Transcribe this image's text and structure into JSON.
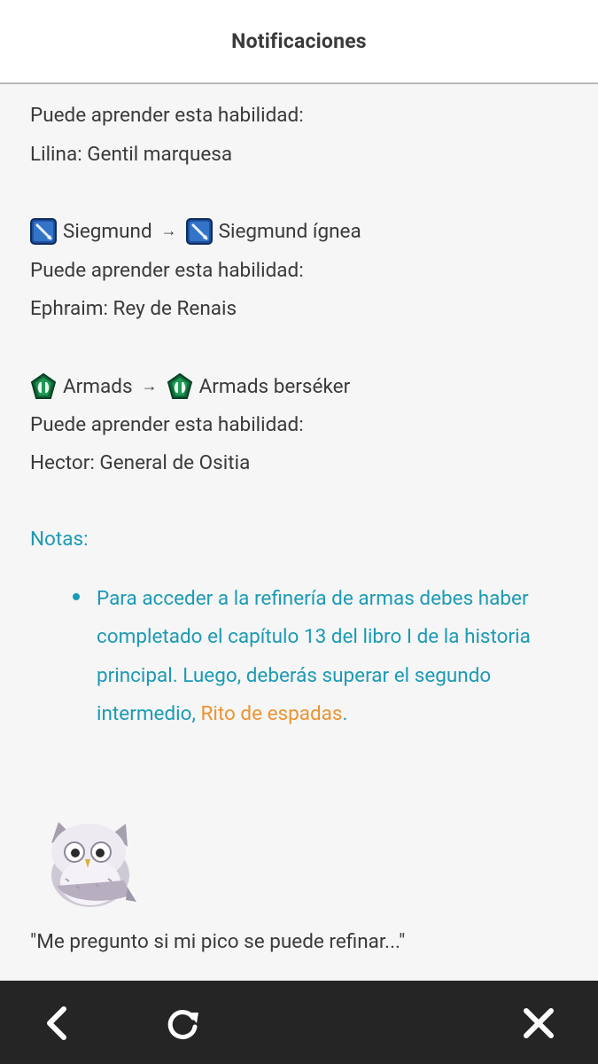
{
  "header": {
    "title": "Notificaciones"
  },
  "blocks": [
    {
      "learn_label": "Puede aprender esta habilidad:",
      "hero": "Lilina: Gentil marquesa"
    },
    {
      "icon": "lance-skill-icon",
      "skill_from": "Siegmund",
      "arrow": "→",
      "skill_to": "Siegmund ígnea",
      "learn_label": "Puede aprender esta habilidad:",
      "hero": "Ephraim: Rey de Renais"
    },
    {
      "icon": "axe-skill-icon",
      "skill_from": "Armads",
      "arrow": "→",
      "skill_to": "Armads berséker",
      "learn_label": "Puede aprender esta habilidad:",
      "hero": "Hector: General de Ositia"
    }
  ],
  "notes": {
    "heading": "Notas:",
    "text": "Para acceder a la refinería de armas debes haber completado el capítulo 13 del libro I de la historia principal. Luego, deberás superar el segundo intermedio, ",
    "link": "Rito de espadas",
    "end": "."
  },
  "quote": "\"Me pregunto si mi pico se puede refinar...\"",
  "colors": {
    "notes_text": "#1c9ab6",
    "link": "#ec9434",
    "bottombar": "#252525"
  },
  "icons": [
    "owl-mascot-icon",
    "back-arrow-icon",
    "refresh-icon",
    "close-icon"
  ]
}
